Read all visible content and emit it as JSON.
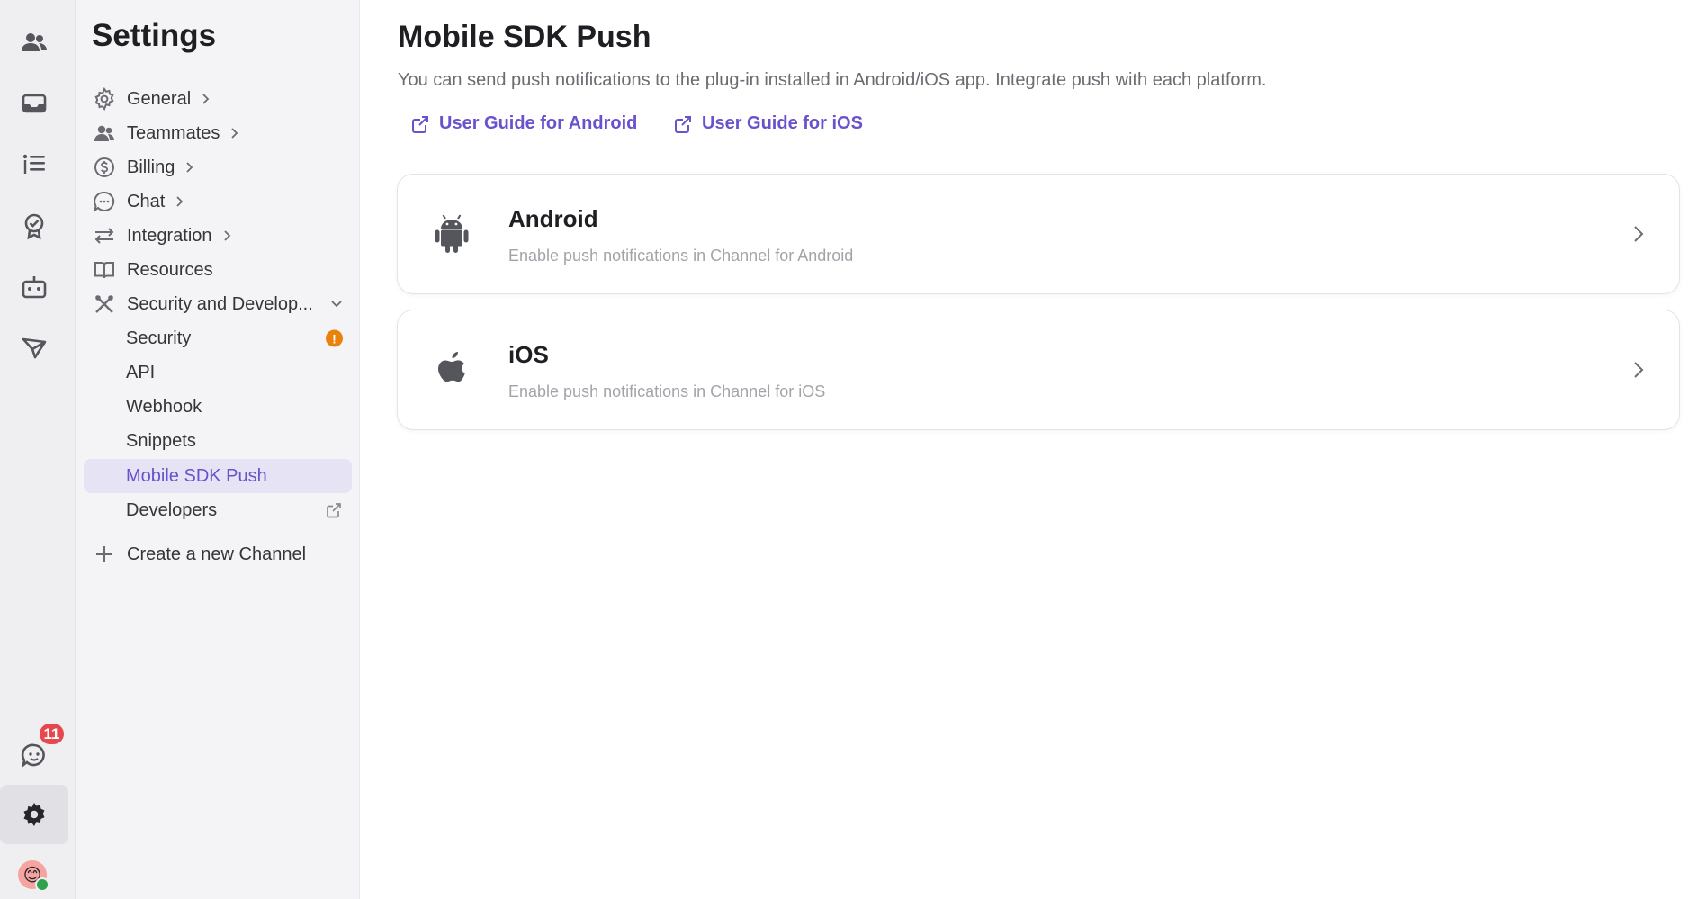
{
  "rail": {
    "items": [
      {
        "icon": "team-icon"
      },
      {
        "icon": "inbox-icon"
      },
      {
        "icon": "list-icon"
      },
      {
        "icon": "badge-check-icon"
      },
      {
        "icon": "bot-icon"
      },
      {
        "icon": "send-icon"
      }
    ],
    "chat_badge_count": "11",
    "avatar_emoji": "😊"
  },
  "sidebar": {
    "title": "Settings",
    "items": [
      {
        "label": "General",
        "icon": "gear-icon"
      },
      {
        "label": "Teammates",
        "icon": "people-icon"
      },
      {
        "label": "Billing",
        "icon": "dollar-icon"
      },
      {
        "label": "Chat",
        "icon": "chat-icon"
      },
      {
        "label": "Integration",
        "icon": "arrows-icon"
      },
      {
        "label": "Resources",
        "icon": "book-icon"
      },
      {
        "label": "Security and Develop...",
        "icon": "tools-icon"
      }
    ],
    "subitems": [
      {
        "label": "Security"
      },
      {
        "label": "API"
      },
      {
        "label": "Webhook"
      },
      {
        "label": "Snippets"
      },
      {
        "label": "Mobile SDK Push"
      },
      {
        "label": "Developers"
      }
    ],
    "warning_mark": "!",
    "create_channel": "Create a new Channel"
  },
  "main": {
    "title": "Mobile SDK Push",
    "description": "You can send push notifications to the plug-in installed in Android/iOS app. Integrate push with each platform.",
    "links": {
      "android": "User Guide for Android",
      "ios": "User Guide for iOS"
    },
    "platforms": [
      {
        "name": "Android",
        "description": "Enable push notifications in Channel for Android"
      },
      {
        "name": "iOS",
        "description": "Enable push notifications in Channel for iOS"
      }
    ]
  },
  "colors": {
    "accent": "#6a52cc",
    "badge": "#e5484d",
    "warning": "#e8820c"
  }
}
